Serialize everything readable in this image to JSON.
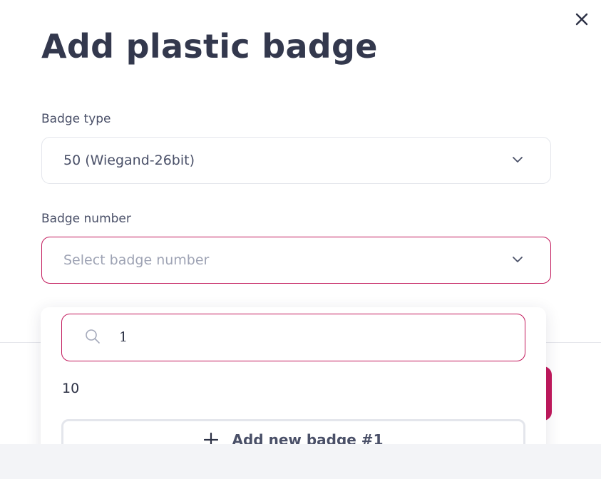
{
  "modal": {
    "title": "Add plastic badge",
    "close_icon": "close-icon"
  },
  "badge_type": {
    "label": "Badge type",
    "value": "50 (Wiegand-26bit)",
    "icon": "chevron-down-icon"
  },
  "badge_number": {
    "label": "Badge number",
    "placeholder": "Select badge number",
    "icon": "chevron-down-icon"
  },
  "dropdown": {
    "search_icon": "search-icon",
    "search_value": "1",
    "options": [
      "10"
    ],
    "add_button_label": "Add new badge #1",
    "add_icon": "plus-icon"
  },
  "colors": {
    "accent": "#c2185b",
    "text": "#33384d",
    "muted": "#9ea3b4",
    "border": "#e4e6ec"
  }
}
